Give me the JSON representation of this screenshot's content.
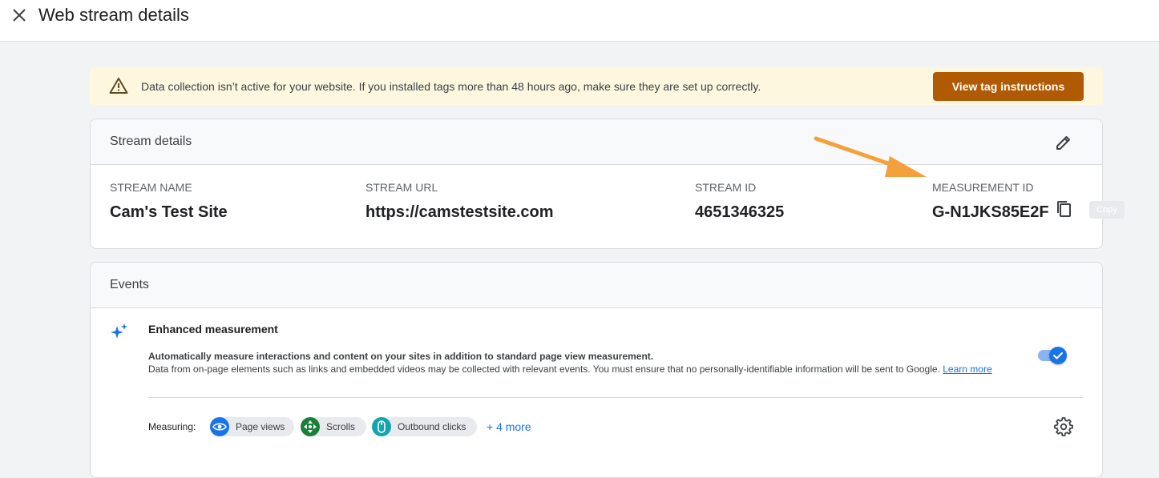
{
  "header": {
    "title": "Web stream details",
    "close_icon": "close-icon"
  },
  "banner": {
    "icon": "warning-icon",
    "message": "Data collection isn’t active for your website. If you installed tags more than 48 hours ago, make sure they are set up correctly.",
    "button_label": "View tag instructions",
    "button_color": "#b05a04",
    "background": "#fef7e0"
  },
  "stream_details": {
    "title": "Stream details",
    "edit_icon": "pencil-icon",
    "fields": [
      {
        "label": "STREAM NAME",
        "value": "Cam's Test Site"
      },
      {
        "label": "STREAM URL",
        "value": "https://camstestsite.com"
      },
      {
        "label": "STREAM ID",
        "value": "4651346325"
      },
      {
        "label": "MEASUREMENT ID",
        "value": "G-N1JKS85E2F"
      }
    ],
    "copy_icon": "copy-icon",
    "copy_tooltip": "Copy"
  },
  "events": {
    "title": "Events",
    "enhanced_measurement": {
      "icon": "sparkle-icon",
      "title": "Enhanced measurement",
      "description_bold": "Automatically measure interactions and content on your sites in addition to standard page view measurement.",
      "description": "Data from on-page elements such as links and embedded videos may be collected with relevant events. You must ensure that no personally-identifiable information will be sent to Google.",
      "learn_more": "Learn more",
      "enabled": true
    },
    "measuring": {
      "label": "Measuring:",
      "chips": [
        {
          "label": "Page views",
          "icon": "eye-icon",
          "color": "#1a73e8"
        },
        {
          "label": "Scrolls",
          "icon": "move-arrows-icon",
          "color": "#188038"
        },
        {
          "label": "Outbound clicks",
          "icon": "mouse-icon",
          "color": "#12a4af"
        }
      ],
      "more_label": "+ 4 more",
      "settings_icon": "gear-icon"
    }
  },
  "annotation": {
    "arrow_color": "#f4a13d"
  }
}
